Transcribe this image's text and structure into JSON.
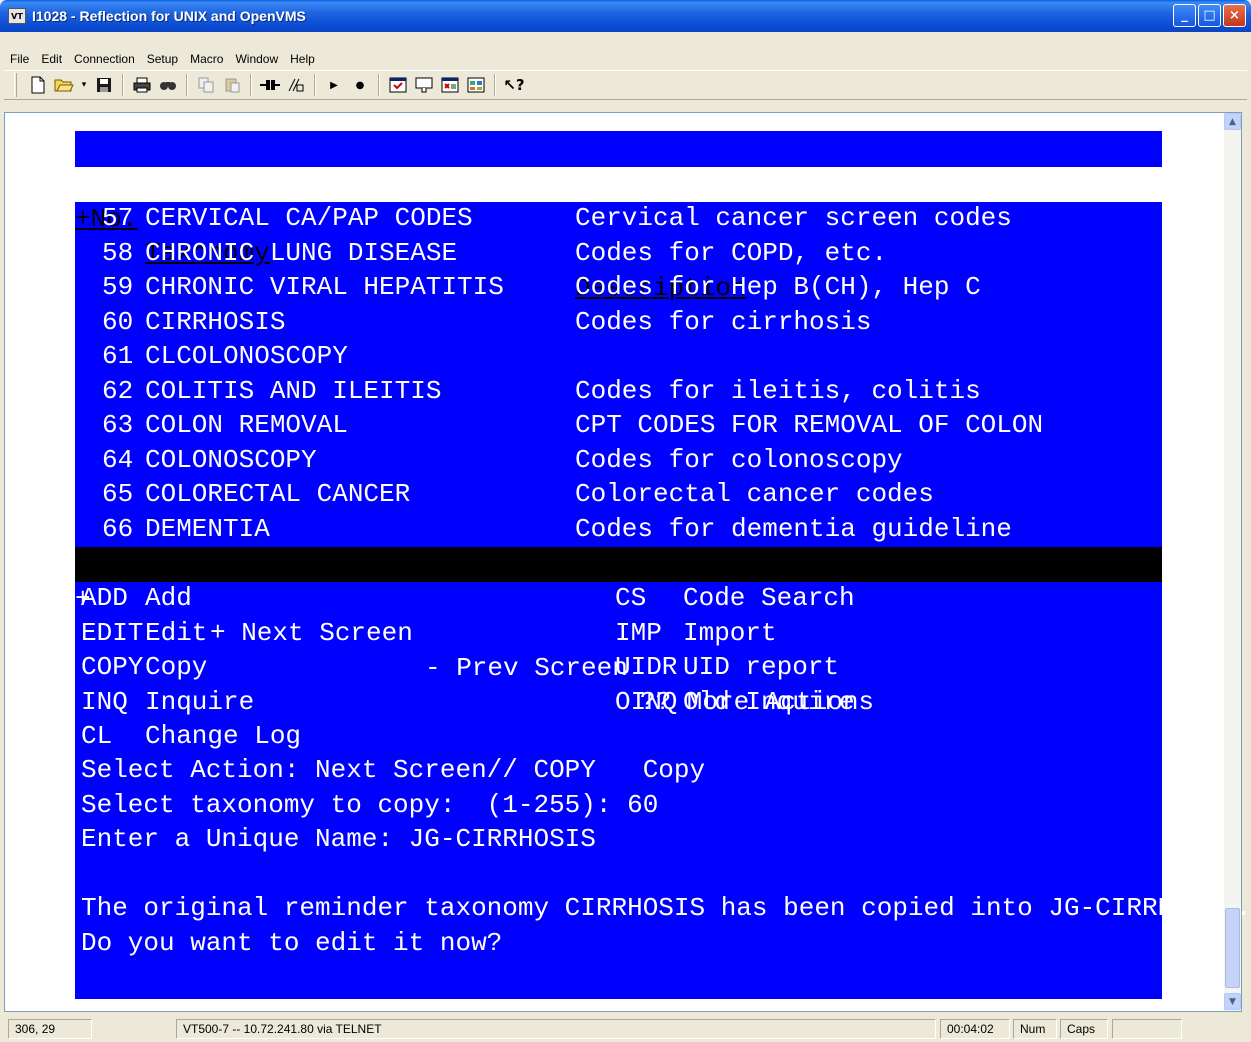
{
  "window": {
    "icon_text": "VT",
    "title": "I1028 - Reflection for UNIX and OpenVMS",
    "minimize": "_",
    "maximize": "□",
    "close": "×"
  },
  "menu": [
    "File",
    "Edit",
    "Connection",
    "Setup",
    "Macro",
    "Window",
    "Help"
  ],
  "toolbar": {
    "icons": [
      "new-icon",
      "open-icon",
      "save-icon",
      "print-icon",
      "find-icon",
      "copy-icon",
      "paste-icon",
      "connect-icon",
      "disconnect-icon",
      "play-macro-icon",
      "record-macro-icon",
      "settings-icon",
      "keyboard-icon",
      "display-icon",
      "toolbar-icon",
      "help-icon"
    ]
  },
  "terminal": {
    "header": {
      "num": "+No.",
      "taxonomy": "Taxonomy",
      "description": "Description"
    },
    "rows": [
      {
        "num": "57",
        "name": "CERVICAL CA/PAP CODES",
        "desc": "Cervical cancer screen codes"
      },
      {
        "num": "58",
        "name": "CHRONIC LUNG DISEASE",
        "desc": "Codes for COPD, etc."
      },
      {
        "num": "59",
        "name": "CHRONIC VIRAL HEPATITIS",
        "desc": "Codes for Hep B(CH), Hep C"
      },
      {
        "num": "60",
        "name": "CIRRHOSIS",
        "desc": "Codes for cirrhosis"
      },
      {
        "num": "61",
        "name": "CLCOLONOSCOPY",
        "desc": ""
      },
      {
        "num": "62",
        "name": "COLITIS AND ILEITIS",
        "desc": "Codes for ileitis, colitis"
      },
      {
        "num": "63",
        "name": "COLON REMOVAL",
        "desc": "CPT CODES FOR REMOVAL OF COLON"
      },
      {
        "num": "64",
        "name": "COLONOSCOPY",
        "desc": "Codes for colonoscopy"
      },
      {
        "num": "65",
        "name": "COLORECTAL CANCER",
        "desc": "Colorectal cancer codes"
      },
      {
        "num": "66",
        "name": "DEMENTIA",
        "desc": "Codes for dementia guideline"
      }
    ],
    "nav_bar": {
      "plus": "+",
      "next": "+ Next Screen",
      "prev": "- Prev Screen",
      "more": "?? More Actions"
    },
    "actions_left": [
      {
        "code": "ADD",
        "label": "Add"
      },
      {
        "code": "EDIT",
        "label": "Edit"
      },
      {
        "code": "COPY",
        "label": "Copy"
      },
      {
        "code": "INQ",
        "label": "Inquire"
      },
      {
        "code": "CL",
        "label": "Change Log"
      }
    ],
    "actions_right": [
      {
        "code": "CS",
        "label": "Code Search"
      },
      {
        "code": "IMP",
        "label": "Import"
      },
      {
        "code": "UIDR",
        "label": "UID report"
      },
      {
        "code": "OINQ",
        "label": "Old Inquire"
      }
    ],
    "prompt_lines": [
      "Select Action: Next Screen// COPY   Copy",
      "Select taxonomy to copy:  (1-255): 60",
      "Enter a Unique Name: JG-CIRRHOSIS",
      "",
      "The original reminder taxonomy CIRRHOSIS has been copied into JG-CIRRHOSIS.",
      "Do you want to edit it now?"
    ]
  },
  "status": {
    "cursor": "306, 29",
    "connection": "VT500-7 -- 10.72.241.80 via TELNET",
    "timer": "00:04:02",
    "num": "Num",
    "caps": "Caps"
  }
}
